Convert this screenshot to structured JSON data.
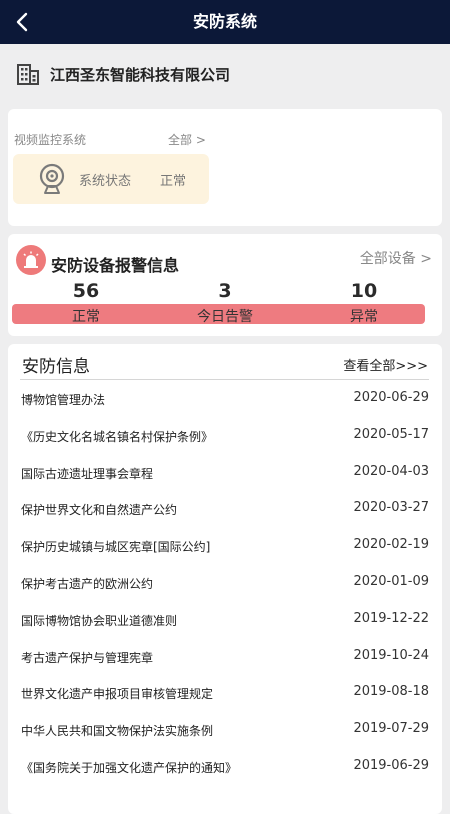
{
  "header": {
    "title": "安防系统",
    "back_icon": "back-arrow-icon"
  },
  "company": {
    "name": "江西圣东智能科技有限公司",
    "icon": "building-icon"
  },
  "monitor": {
    "label": "视频监控系统",
    "all": "全部 >",
    "status_label": "系统状态",
    "status_value": "正常",
    "icon": "webcam-icon"
  },
  "alarm": {
    "title": "安防设备报警信息",
    "all": "全部设备 >",
    "icon": "alarm-siren-icon",
    "accent": "#ee7b80",
    "stats": [
      {
        "value": "56",
        "label": "正常"
      },
      {
        "value": "3",
        "label": "今日告警"
      },
      {
        "value": "10",
        "label": "异常"
      }
    ]
  },
  "news": {
    "title": "安防信息",
    "more": "查看全部>>>",
    "items": [
      {
        "title": "博物馆管理办法",
        "date": "2020-06-29"
      },
      {
        "title": "《历史文化名城名镇名村保护条例》",
        "date": "2020-05-17"
      },
      {
        "title": "国际古迹遗址理事会章程",
        "date": "2020-04-03"
      },
      {
        "title": "保护世界文化和自然遗产公约",
        "date": "2020-03-27"
      },
      {
        "title": "保护历史城镇与城区宪章[国际公约]",
        "date": "2020-02-19"
      },
      {
        "title": "保护考古遗产的欧洲公约",
        "date": "2020-01-09"
      },
      {
        "title": "国际博物馆协会职业道德准则",
        "date": "2019-12-22"
      },
      {
        "title": "考古遗产保护与管理宪章",
        "date": "2019-10-24"
      },
      {
        "title": "世界文化遗产申报项目审核管理规定",
        "date": "2019-08-18"
      },
      {
        "title": "中华人民共和国文物保护法实施条例",
        "date": "2019-07-29"
      },
      {
        "title": "《国务院关于加强文化遗产保护的通知》",
        "date": "2019-06-29"
      }
    ]
  }
}
